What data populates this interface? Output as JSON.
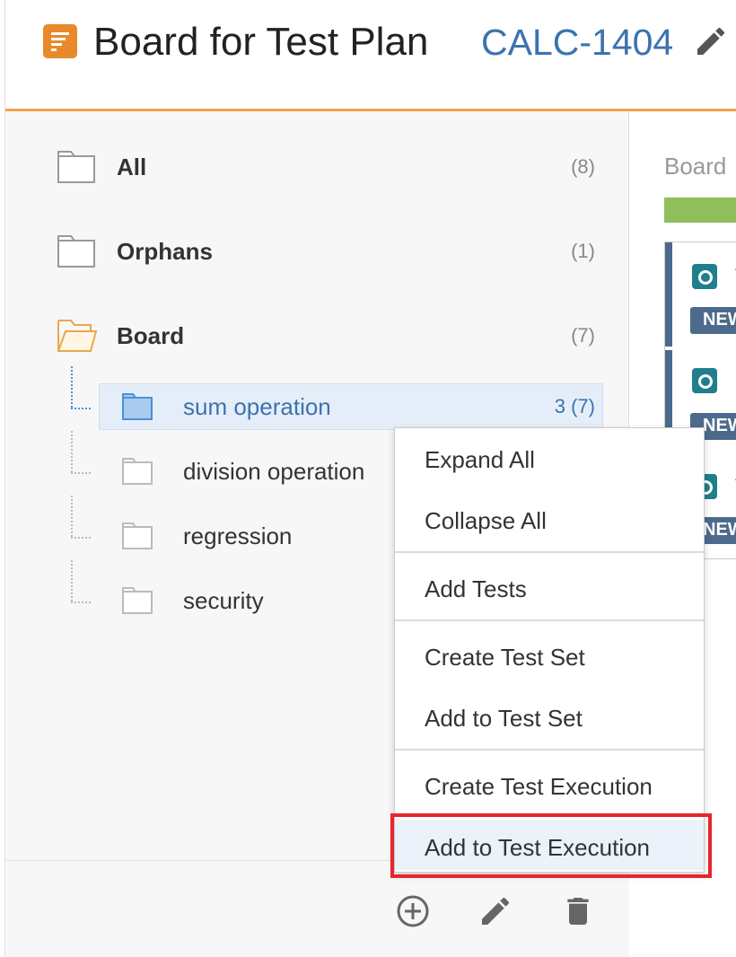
{
  "header": {
    "title": "Board for Test Plan",
    "issue_key": "CALC-1404",
    "icon_color": "#e8892b"
  },
  "folders": [
    {
      "name": "All",
      "count": "(8)"
    },
    {
      "name": "Orphans",
      "count": "(1)"
    },
    {
      "name": "Board",
      "count": "(7)"
    }
  ],
  "subfolders": [
    {
      "name": "sum operation",
      "count": "3 (7)",
      "selected": true
    },
    {
      "name": "division operation",
      "count": ""
    },
    {
      "name": "regression",
      "count": ""
    },
    {
      "name": "security",
      "count": ""
    }
  ],
  "context_menu": {
    "items": [
      "Expand All",
      "Collapse All",
      "Add Tests",
      "Create Test Set",
      "Add to Test Set",
      "Create Test Execution",
      "Add to Test Execution"
    ],
    "highlighted": "Add to Test Execution"
  },
  "right_panel": {
    "board_label": "Board",
    "cards": [
      {
        "status": "NEW"
      },
      {
        "status": "NEW"
      },
      {
        "status": "NEW"
      }
    ]
  },
  "footer": {
    "icons": [
      "add-icon",
      "edit-icon",
      "trash-icon"
    ]
  },
  "colors": {
    "accent_orange": "#f0a34a",
    "link_blue": "#3b73af",
    "selected_bg": "#e5eef8",
    "highlight_red": "#e8252b",
    "progress_green": "#8fbf5a"
  }
}
